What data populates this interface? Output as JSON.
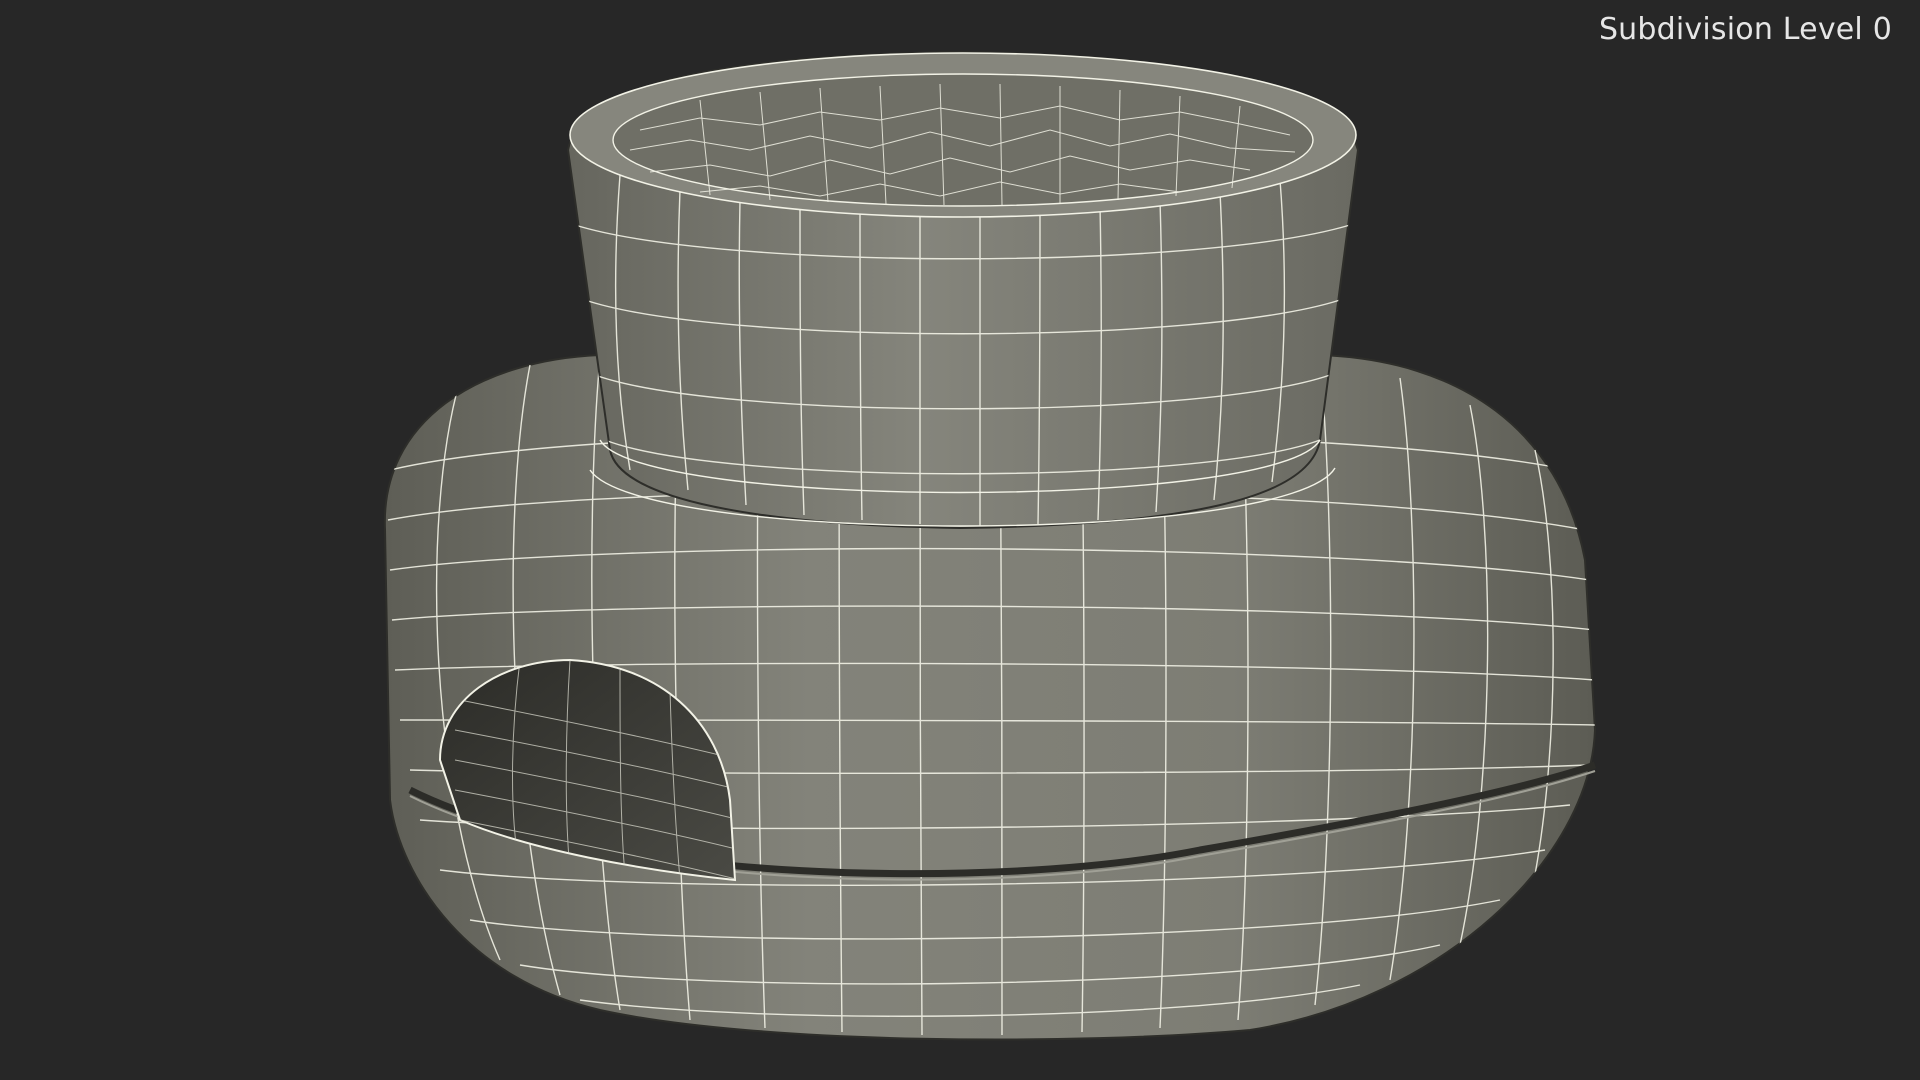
{
  "viewport": {
    "subdivision_label": "Subdivision Level 0"
  },
  "model": {
    "description_icon": "wireframe-mesh-icon",
    "colors": {
      "background": "#272727",
      "surface": "#7a7a70",
      "surface_dark": "#5a5a52",
      "surface_shadow": "#3e3e38",
      "wire": "#f2f2e6"
    }
  }
}
